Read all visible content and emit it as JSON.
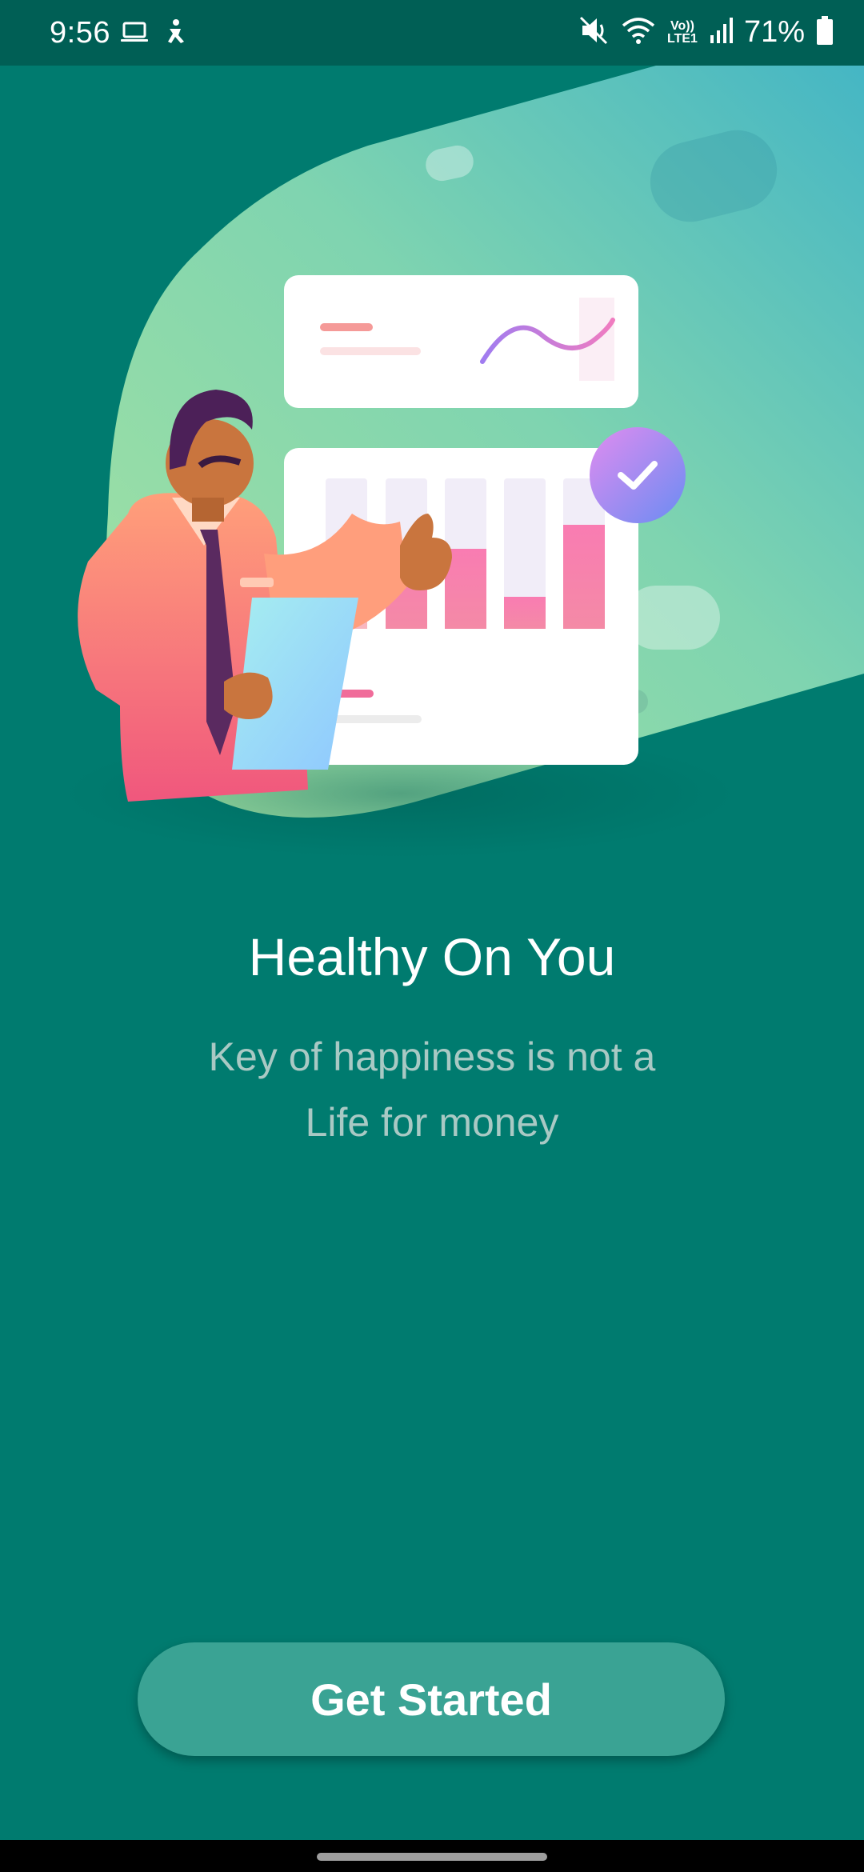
{
  "status_bar": {
    "time": "9:56",
    "left_icons": [
      "laptop-icon",
      "accessibility-icon"
    ],
    "right_icons": [
      "mute-icon",
      "wifi-icon",
      "volte-lte-icon",
      "signal-icon",
      "battery-icon"
    ],
    "volte_label": "Vo))",
    "lte_label": "LTE1",
    "battery_percent": "71%"
  },
  "onboarding": {
    "illustration": "businessman-presenting-chart-illustration",
    "title": "Healthy On You",
    "subtitle_line1": "Key of happiness is not a",
    "subtitle_line2": "Life for money",
    "cta_label": "Get Started"
  },
  "colors": {
    "background": "#007b6f",
    "status_bar": "#005f55",
    "button": "#3aa394",
    "subtitle_text": "#a9c9c4"
  }
}
